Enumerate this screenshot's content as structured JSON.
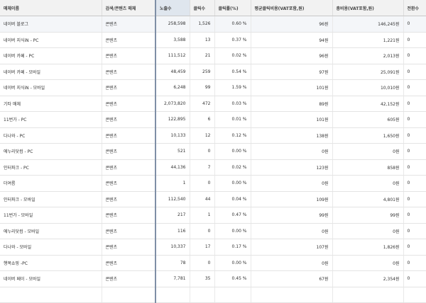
{
  "columns": [
    "매체이름",
    "검색/콘텐츠 매체",
    "노출수",
    "클릭수",
    "클릭률(%)",
    "평균클릭비용(VAT포함,원)",
    "총비용(VAT포함,원)",
    "전환수"
  ],
  "rows": [
    [
      "네이버 블로그",
      "콘텐츠",
      "258,598",
      "1,526",
      "0.60 %",
      "96원",
      "146,245원",
      "0"
    ],
    [
      "네이버 지식iN - PC",
      "콘텐츠",
      "3,588",
      "13",
      "0.37 %",
      "94원",
      "1,221원",
      "0"
    ],
    [
      "네이버 카페 - PC",
      "콘텐츠",
      "111,512",
      "21",
      "0.02 %",
      "96원",
      "2,013원",
      "0"
    ],
    [
      "네이버 카페 - 모바일",
      "콘텐츠",
      "48,459",
      "259",
      "0.54 %",
      "97원",
      "25,091원",
      "0"
    ],
    [
      "네이버 지식iN - 모바일",
      "콘텐츠",
      "6,248",
      "99",
      "1.59 %",
      "101원",
      "10,010원",
      "0"
    ],
    [
      "기타 매체",
      "콘텐츠",
      "2,073,820",
      "472",
      "0.03 %",
      "89원",
      "42,152원",
      "0"
    ],
    [
      "11번가 - PC",
      "콘텐츠",
      "122,895",
      "6",
      "0.01 %",
      "101원",
      "605원",
      "0"
    ],
    [
      "다나와 - PC",
      "콘텐츠",
      "10,133",
      "12",
      "0.12 %",
      "138원",
      "1,650원",
      "0"
    ],
    [
      "에누리닷컴 - PC",
      "콘텐츠",
      "521",
      "0",
      "0.00 %",
      "0원",
      "0원",
      "0"
    ],
    [
      "인터파크 - PC",
      "콘텐츠",
      "44,136",
      "7",
      "0.02 %",
      "123원",
      "858원",
      "0"
    ],
    [
      "더여름",
      "콘텐츠",
      "1",
      "0",
      "0.00 %",
      "0원",
      "0원",
      "0"
    ],
    [
      "인터파크 - 모바일",
      "콘텐츠",
      "112,540",
      "44",
      "0.04 %",
      "109원",
      "4,801원",
      "0"
    ],
    [
      "11번가 - 모바일",
      "콘텐츠",
      "217",
      "1",
      "0.47 %",
      "99원",
      "99원",
      "0"
    ],
    [
      "에누리닷컴 - 모바일",
      "콘텐츠",
      "116",
      "0",
      "0.00 %",
      "0원",
      "0원",
      "0"
    ],
    [
      "다나와 - 모바일",
      "콘텐츠",
      "10,337",
      "17",
      "0.17 %",
      "107원",
      "1,826원",
      "0"
    ],
    [
      "행복쇼핑 -PC",
      "콘텐츠",
      "78",
      "0",
      "0.00 %",
      "0원",
      "0원",
      "0"
    ],
    [
      "네이버 페이 - 모바일",
      "콘텐츠",
      "7,781",
      "35",
      "0.45 %",
      "67원",
      "2,354원",
      "0"
    ],
    [
      "",
      "",
      "",
      "",
      "",
      "",
      "",
      ""
    ]
  ]
}
